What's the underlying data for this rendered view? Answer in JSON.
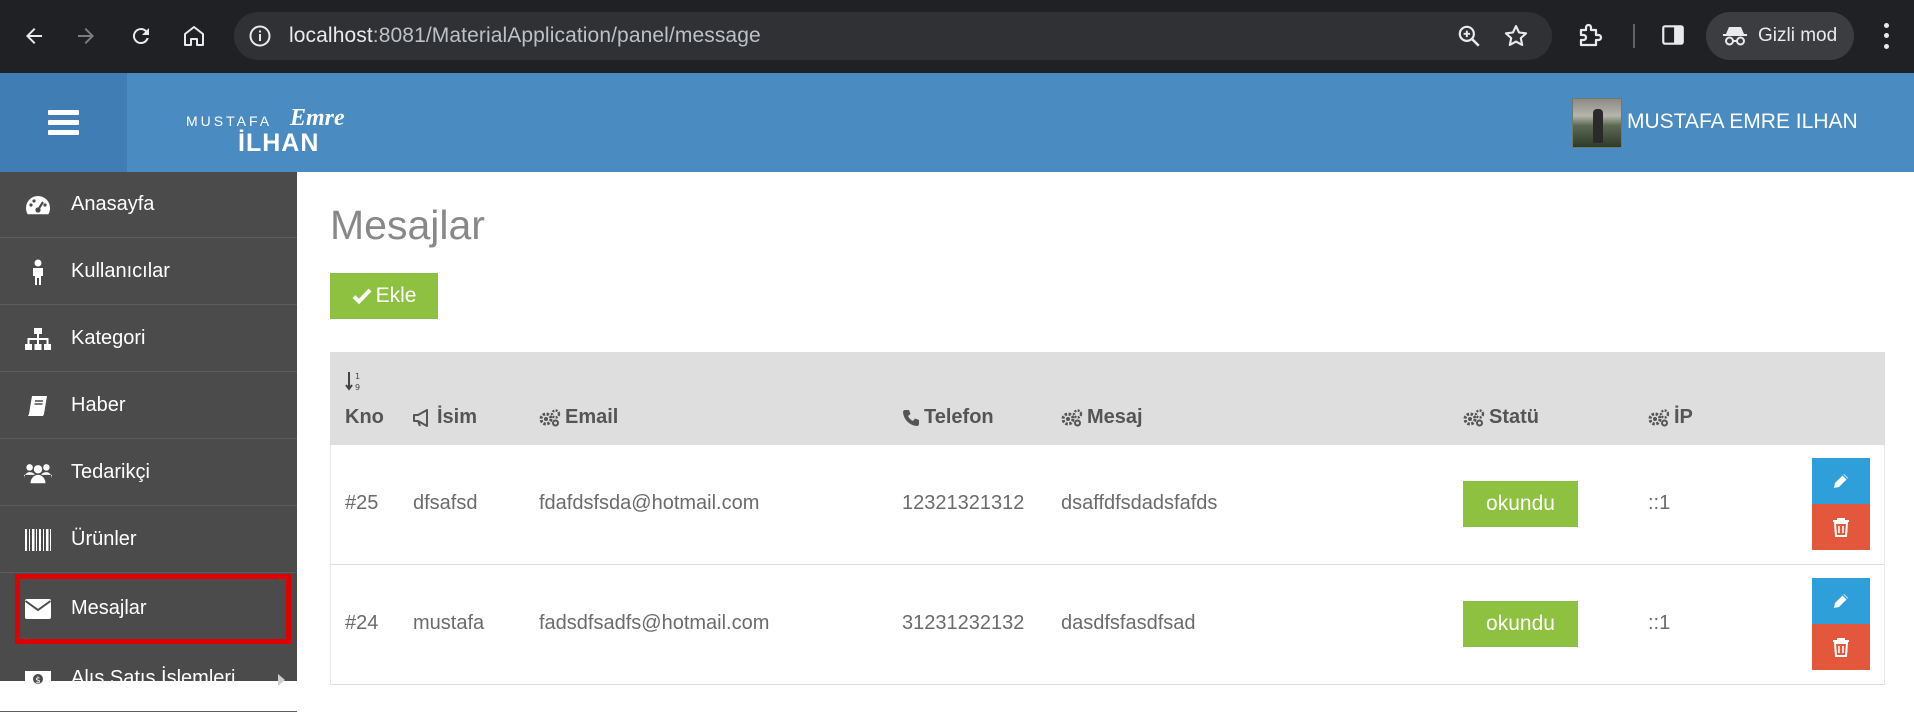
{
  "browser": {
    "url_host": "localhost",
    "url_path": ":8081/MaterialApplication/panel/message",
    "incognito_label": "Gizli mod"
  },
  "header": {
    "logo_top": "MUSTAFA",
    "logo_script": "Emre",
    "logo_bottom": "İLHAN",
    "user_name": "MUSTAFA EMRE ILHAN"
  },
  "sidebar": {
    "items": [
      {
        "label": "Anasayfa",
        "icon": "dashboard-icon"
      },
      {
        "label": "Kullanıcılar",
        "icon": "user-icon"
      },
      {
        "label": "Kategori",
        "icon": "sitemap-icon"
      },
      {
        "label": "Haber",
        "icon": "book-icon"
      },
      {
        "label": "Tedarikçi",
        "icon": "users-icon"
      },
      {
        "label": "Ürünler",
        "icon": "barcode-icon"
      },
      {
        "label": "Mesajlar",
        "icon": "envelope-icon",
        "active": true
      },
      {
        "label": "Alış Satış İşlemleri",
        "icon": "money-icon"
      }
    ]
  },
  "main": {
    "title": "Mesajlar",
    "add_button": "Ekle",
    "table": {
      "columns": [
        "Kno",
        "İsim",
        "Email",
        "Telefon",
        "Mesaj",
        "Statü",
        "İP"
      ],
      "rows": [
        {
          "kno": "#25",
          "isim": "dfsafsd",
          "email": "fdafdsfsda@hotmail.com",
          "telefon": "12321321312",
          "mesaj": "dsaffdfsdadsfafds",
          "statu": "okundu",
          "ip": "::1"
        },
        {
          "kno": "#24",
          "isim": "mustafa",
          "email": "fadsdfsadfs@hotmail.com",
          "telefon": "31231232132",
          "mesaj": "dasdfsfasdfsad",
          "statu": "okundu",
          "ip": "::1"
        }
      ]
    }
  },
  "colors": {
    "header_blue": "#4a8bc2",
    "sidebar_bg": "#4b4b4b",
    "success_green": "#8dc13f",
    "edit_blue": "#2e9fd9",
    "delete_red": "#e3573c",
    "highlight_red": "#e00000"
  }
}
